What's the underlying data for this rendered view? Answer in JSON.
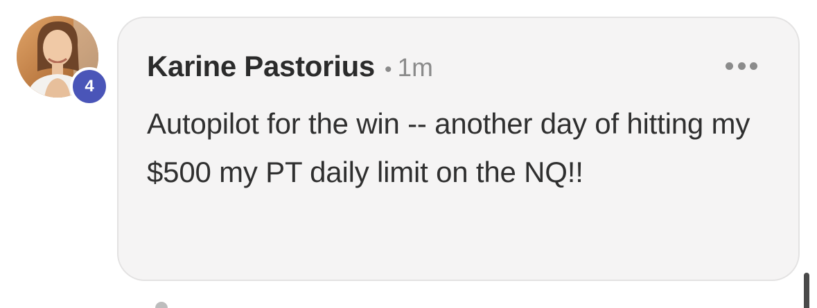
{
  "comment": {
    "author": "Karine Pastorius",
    "separator": "•",
    "timestamp": "1m",
    "body": "Autopilot for the win -- another day of hitting my $500 my PT daily limit on the NQ!!",
    "more_icon": "more-horizontal-icon"
  },
  "avatar": {
    "badge_count": "4",
    "badge_color": "#4a55b8"
  },
  "colors": {
    "card_background": "#f5f4f4",
    "card_border": "#e3e2e2",
    "text_primary": "#2b2b2b",
    "text_secondary": "#8a8a8a"
  }
}
